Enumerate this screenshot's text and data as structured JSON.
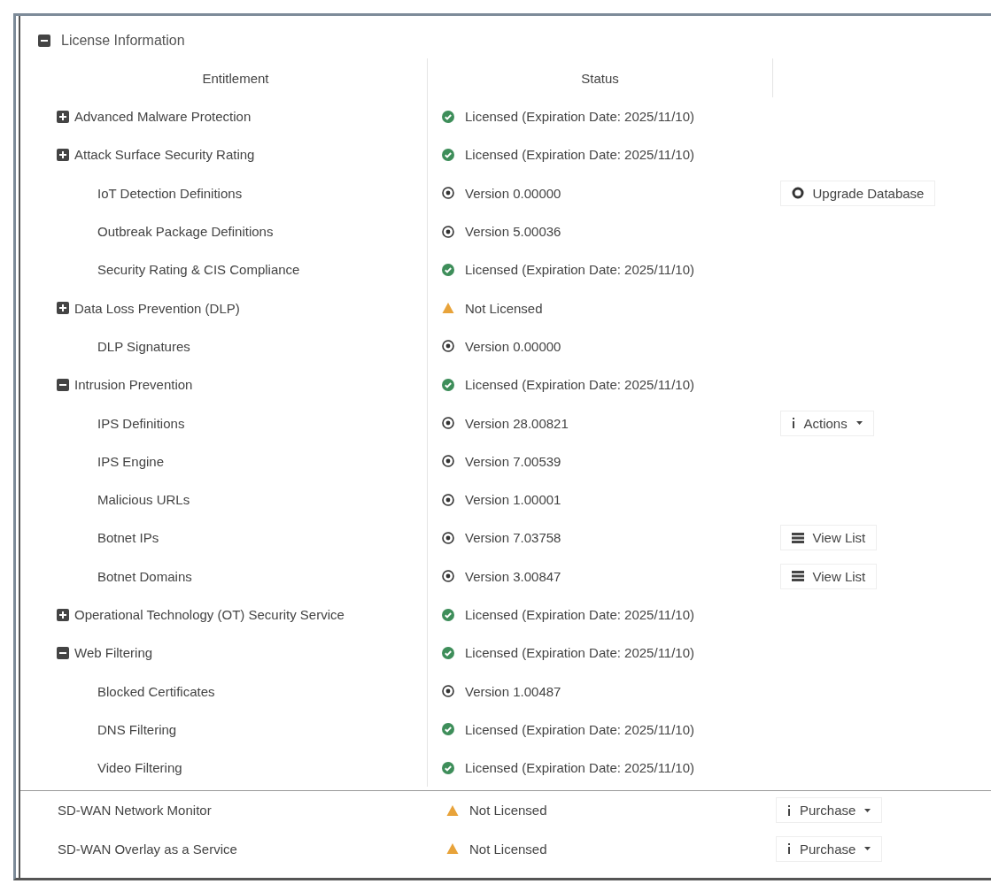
{
  "section": {
    "title": "License Information",
    "expanded": true
  },
  "table": {
    "columns": [
      "Entitlement",
      "Status"
    ],
    "rows": [
      {
        "name": "Advanced Malware Protection",
        "expanded": false,
        "status": {
          "kind": "licensed",
          "text": "Licensed (Expiration Date: 2025/11/10)"
        }
      },
      {
        "name": "Attack Surface Security Rating",
        "expanded": false,
        "status": {
          "kind": "licensed",
          "text": "Licensed (Expiration Date: 2025/11/10)"
        },
        "children": [
          {
            "name": "IoT Detection Definitions",
            "status": {
              "kind": "version",
              "text": "Version 0.00000"
            },
            "action": {
              "kind": "upgrade",
              "label": "Upgrade Database"
            }
          },
          {
            "name": "Outbreak Package Definitions",
            "status": {
              "kind": "version",
              "text": "Version 5.00036"
            }
          },
          {
            "name": "Security Rating & CIS Compliance",
            "status": {
              "kind": "licensed",
              "text": "Licensed (Expiration Date: 2025/11/10)"
            }
          }
        ]
      },
      {
        "name": "Data Loss Prevention (DLP)",
        "expanded": false,
        "status": {
          "kind": "warning",
          "text": "Not Licensed"
        },
        "children": [
          {
            "name": "DLP Signatures",
            "status": {
              "kind": "version",
              "text": "Version 0.00000"
            }
          }
        ]
      },
      {
        "name": "Intrusion Prevention",
        "expanded": true,
        "status": {
          "kind": "licensed",
          "text": "Licensed (Expiration Date: 2025/11/10)"
        },
        "children": [
          {
            "name": "IPS Definitions",
            "status": {
              "kind": "version",
              "text": "Version 28.00821"
            },
            "action": {
              "kind": "menu",
              "label": "Actions"
            }
          },
          {
            "name": "IPS Engine",
            "status": {
              "kind": "version",
              "text": "Version 7.00539"
            }
          },
          {
            "name": "Malicious URLs",
            "status": {
              "kind": "version",
              "text": "Version 1.00001"
            }
          },
          {
            "name": "Botnet IPs",
            "status": {
              "kind": "version",
              "text": "Version 7.03758"
            },
            "action": {
              "kind": "list",
              "label": "View List"
            }
          },
          {
            "name": "Botnet Domains",
            "status": {
              "kind": "version",
              "text": "Version 3.00847"
            },
            "action": {
              "kind": "list",
              "label": "View List"
            }
          }
        ]
      },
      {
        "name": "Operational Technology (OT) Security Service",
        "expanded": false,
        "status": {
          "kind": "licensed",
          "text": "Licensed (Expiration Date: 2025/11/10)"
        }
      },
      {
        "name": "Web Filtering",
        "expanded": true,
        "status": {
          "kind": "licensed",
          "text": "Licensed (Expiration Date: 2025/11/10)"
        },
        "children": [
          {
            "name": "Blocked Certificates",
            "status": {
              "kind": "version",
              "text": "Version 1.00487"
            }
          },
          {
            "name": "DNS Filtering",
            "status": {
              "kind": "licensed",
              "text": "Licensed (Expiration Date: 2025/11/10)"
            }
          },
          {
            "name": "Video Filtering",
            "status": {
              "kind": "licensed",
              "text": "Licensed (Expiration Date: 2025/11/10)"
            }
          }
        ]
      }
    ]
  },
  "extra_rows": [
    {
      "name": "SD-WAN Network Monitor",
      "status": {
        "kind": "warning",
        "text": "Not Licensed"
      },
      "action": {
        "kind": "menu",
        "label": "Purchase"
      }
    },
    {
      "name": "SD-WAN Overlay as a Service",
      "status": {
        "kind": "warning",
        "text": "Not Licensed"
      },
      "action": {
        "kind": "menu",
        "label": "Purchase"
      }
    }
  ]
}
